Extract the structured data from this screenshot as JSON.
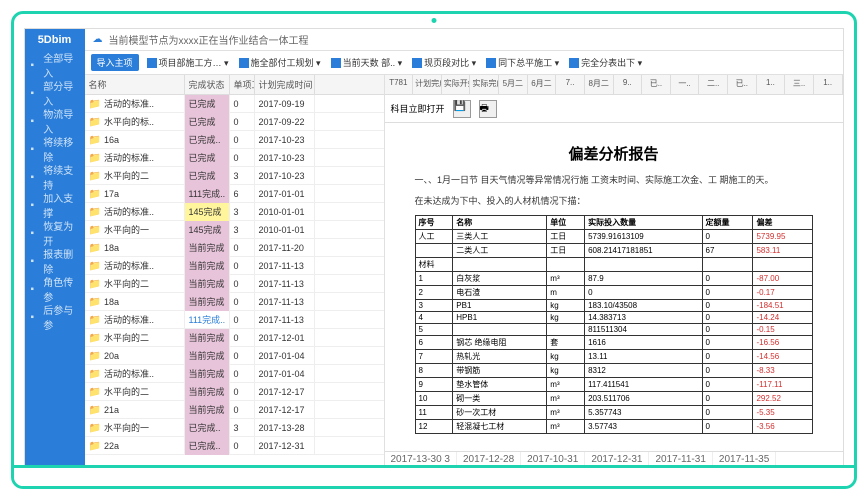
{
  "logo": "5Dbim",
  "cloud_text": "当前模型节点为xxxx正在当作业结合一体工程",
  "nav": [
    {
      "label": "全部导入"
    },
    {
      "label": "部分导入"
    },
    {
      "label": "物流导入"
    },
    {
      "label": "将续移除"
    },
    {
      "label": "将续支持"
    },
    {
      "label": "加入支撑"
    },
    {
      "label": "恢复为开"
    },
    {
      "label": "报表删除"
    },
    {
      "label": "角色传参"
    },
    {
      "label": "后参与参"
    }
  ],
  "toolbar": {
    "main_btn": "导入主项",
    "items": [
      "项目部施工方…",
      "施全部付工规划",
      "当前天数  部..",
      "现页段对比",
      "同下总平施工",
      "完全分表出下"
    ]
  },
  "grid": {
    "headers": [
      "名称",
      "完成状态",
      "单项工程",
      "计划完成时间"
    ],
    "rows": [
      {
        "name": "活动的标准..",
        "status": "已完成",
        "n": "0",
        "date": "2017-09-19",
        "cls": ""
      },
      {
        "name": "水平向的标..",
        "status": "已完成",
        "n": "0",
        "date": "2017-09-22",
        "cls": "pink"
      },
      {
        "name": "16a",
        "status": "已完成..",
        "n": "0",
        "date": "2017-10-23",
        "cls": ""
      },
      {
        "name": "活动的标准..",
        "status": "已完成",
        "n": "0",
        "date": "2017-10-23",
        "cls": ""
      },
      {
        "name": "水平向的二",
        "status": "已完成",
        "n": "3",
        "date": "2017-10-23",
        "cls": "pink"
      },
      {
        "name": "17a",
        "status": "111完成..",
        "n": "6",
        "date": "2017-01-01",
        "cls": ""
      },
      {
        "name": "活动的标准..",
        "status": "145完成",
        "n": "3",
        "date": "2010-01-01",
        "cls": "yellow"
      },
      {
        "name": "水平向的一",
        "status": "145完成",
        "n": "3",
        "date": "2010-01-01",
        "cls": ""
      },
      {
        "name": "18a",
        "status": "当前完成",
        "n": "0",
        "date": "2017-11-20",
        "cls": ""
      },
      {
        "name": "活动的标准..",
        "status": "当前完成",
        "n": "0",
        "date": "2017-11-13",
        "cls": ""
      },
      {
        "name": "水平向的二",
        "status": "当前完成",
        "n": "0",
        "date": "2017-11-13",
        "cls": ""
      },
      {
        "name": "18a",
        "status": "当前完成",
        "n": "0",
        "date": "2017-11-13",
        "cls": ""
      },
      {
        "name": "活动的标准..",
        "status": "111完成..",
        "n": "0",
        "date": "2017-11-13",
        "cls": "blue-txt"
      },
      {
        "name": "水平向的二",
        "status": "当前完成",
        "n": "0",
        "date": "2017-12-01",
        "cls": ""
      },
      {
        "name": "20a",
        "status": "当前完成",
        "n": "0",
        "date": "2017-01-04",
        "cls": ""
      },
      {
        "name": "活动的标准..",
        "status": "当前完成",
        "n": "0",
        "date": "2017-01-04",
        "cls": ""
      },
      {
        "name": "水平向的二",
        "status": "当前完成",
        "n": "0",
        "date": "2017-12-17",
        "cls": ""
      },
      {
        "name": "21a",
        "status": "当前完成",
        "n": "0",
        "date": "2017-12-17",
        "cls": ""
      },
      {
        "name": "水平向的一",
        "status": "已完成..",
        "n": "3",
        "date": "2017-13-28",
        "cls": "pink"
      },
      {
        "name": "22a",
        "status": "已完成..",
        "n": "0",
        "date": "2017-12-31",
        "cls": "pink"
      }
    ]
  },
  "right_headers": [
    "T781",
    "计划完成",
    "实际开始",
    "实际完成",
    "5月二",
    "6月二",
    "7..",
    "8月二",
    "9..",
    "已..",
    "一..",
    "二..",
    "已..",
    "1..",
    "三..",
    "1.."
  ],
  "right_toolbar_label": "科目立即打开",
  "report": {
    "title": "偏差分析报告",
    "desc1": "一、、1月一日节  目天气情况等异常情况行施 工资末时间、实际施工次金、工 期施工的天。",
    "desc2": "在未达成为下中、投入的人材机情况下描：",
    "table": {
      "head": [
        "序号",
        "名称",
        "单位",
        "实际投入数量",
        "定额量",
        "偏差"
      ],
      "rows": [
        [
          "人工",
          "三类人工",
          "工日",
          "5739.91613109",
          "0",
          "5739.95"
        ],
        [
          "",
          "二类人工",
          "工日",
          "608.21417181851",
          "67",
          "583.11"
        ],
        [
          "材料",
          "",
          "",
          "",
          "",
          ""
        ],
        [
          "1",
          "白灰浆",
          "m³",
          "87.9",
          "0",
          "-87.00"
        ],
        [
          "2",
          "电石渣",
          "m",
          "0",
          "0",
          "-0.17"
        ],
        [
          "3",
          "PB1",
          "kg",
          "183.10/43508",
          "0",
          "-184.51"
        ],
        [
          "4",
          "HPB1",
          "kg",
          "14.383713",
          "0",
          "-14.24"
        ],
        [
          "5",
          "",
          "",
          "811511304",
          "0",
          "-0.15"
        ],
        [
          "6",
          "钢芯  绝缘电阻",
          "套",
          "1616",
          "0",
          "-16.56"
        ],
        [
          "7",
          "热轧光",
          "kg",
          "13.11",
          "0",
          "-14.56"
        ],
        [
          "8",
          "带钢筋",
          "kg",
          "8312",
          "0",
          "-8.33"
        ],
        [
          "9",
          "垫水管体",
          "m³",
          "117.411541",
          "0",
          "-117.11"
        ],
        [
          "10",
          "砌一类",
          "m³",
          "203.511706",
          "0",
          "292.52"
        ],
        [
          "11",
          "砂一次工材",
          "m³",
          "5.357743",
          "0",
          "-5.35"
        ],
        [
          "12",
          "轻混凝七工材",
          "m³",
          "3.57743",
          "0",
          "-3.56"
        ]
      ]
    }
  },
  "bottom_dates": [
    "2017-13-30  3",
    "2017-12-28",
    "2017-10-31",
    "2017-12-31",
    "2017-11-31",
    "2017-11-35"
  ]
}
